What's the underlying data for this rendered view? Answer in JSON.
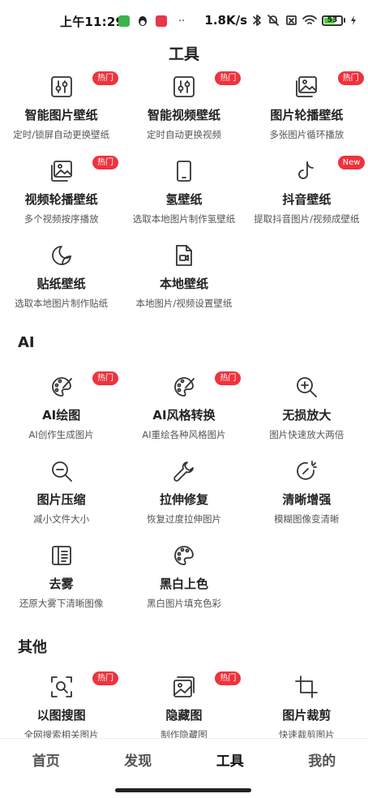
{
  "status_bar": {
    "time": "上午11:29",
    "network_speed": "1.8K/s",
    "battery": "53",
    "dots": "··"
  },
  "page_title": "工具",
  "sections": {
    "wallpaper": {
      "items": [
        {
          "name": "智能图片壁纸",
          "desc": "定时/锁屏自动更换壁纸",
          "badge": "热门",
          "icon": "sliders-icon"
        },
        {
          "name": "智能视频壁纸",
          "desc": "定时自动更换视频",
          "badge": "热门",
          "icon": "sliders-icon"
        },
        {
          "name": "图片轮播壁纸",
          "desc": "多张图片循环播放",
          "badge": "热门",
          "icon": "image-stack-icon"
        },
        {
          "name": "视频轮播壁纸",
          "desc": "多个视频按序播放",
          "badge": "热门",
          "icon": "image-stack-icon"
        },
        {
          "name": "氢壁纸",
          "desc": "选取本地图片制作氢壁纸",
          "badge": "",
          "icon": "phone-icon"
        },
        {
          "name": "抖音壁纸",
          "desc": "提取抖音图片/视频成壁纸",
          "badge": "New",
          "icon": "tiktok-icon"
        },
        {
          "name": "贴纸壁纸",
          "desc": "选取本地图片制作贴纸",
          "badge": "",
          "icon": "sticker-icon"
        },
        {
          "name": "本地壁纸",
          "desc": "本地图片/视频设置壁纸",
          "badge": "",
          "icon": "file-video-icon"
        }
      ]
    },
    "ai": {
      "title": "AI",
      "items": [
        {
          "name": "AI绘图",
          "desc": "AI创作生成图片",
          "badge": "热门",
          "icon": "palette-brush-icon"
        },
        {
          "name": "AI风格转换",
          "desc": "AI重绘各种风格图片",
          "badge": "热门",
          "icon": "palette-brush-icon"
        },
        {
          "name": "无损放大",
          "desc": "图片快速放大两倍",
          "badge": "",
          "icon": "zoom-in-icon"
        },
        {
          "name": "图片压缩",
          "desc": "减小文件大小",
          "badge": "",
          "icon": "zoom-out-icon"
        },
        {
          "name": "拉伸修复",
          "desc": "恢复过度拉伸图片",
          "badge": "",
          "icon": "wrench-icon"
        },
        {
          "name": "清晰增强",
          "desc": "模糊图像变清晰",
          "badge": "",
          "icon": "sparkle-icon"
        },
        {
          "name": "去雾",
          "desc": "还原大雾下清晰图像",
          "badge": "",
          "icon": "dehaze-icon"
        },
        {
          "name": "黑白上色",
          "desc": "黑白图片填充色彩",
          "badge": "",
          "icon": "palette-icon"
        }
      ]
    },
    "other": {
      "title": "其他",
      "items": [
        {
          "name": "以图搜图",
          "desc": "全网搜索相关图片",
          "badge": "热门",
          "icon": "image-search-icon"
        },
        {
          "name": "隐藏图",
          "desc": "制作隐藏图",
          "badge": "热门",
          "icon": "hidden-image-icon"
        },
        {
          "name": "图片裁剪",
          "desc": "快速裁剪图片",
          "badge": "",
          "icon": "crop-icon"
        }
      ]
    }
  },
  "tabs": [
    {
      "label": "首页",
      "active": false
    },
    {
      "label": "发现",
      "active": false
    },
    {
      "label": "工具",
      "active": true
    },
    {
      "label": "我的",
      "active": false
    }
  ],
  "colors": {
    "badge": "#f0323c",
    "text": "#222222",
    "subtext": "#555555"
  }
}
